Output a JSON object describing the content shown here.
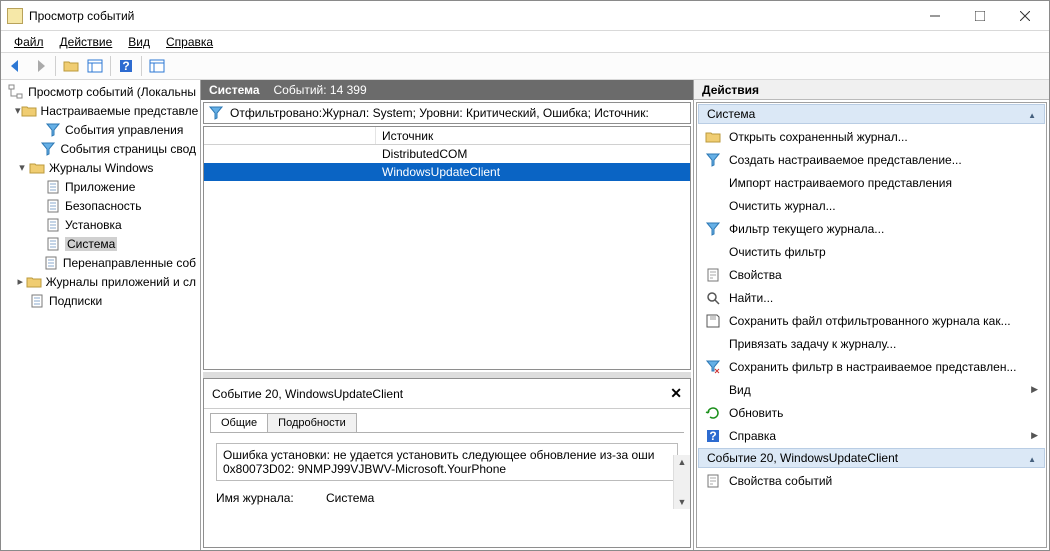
{
  "window": {
    "title": "Просмотр событий"
  },
  "menu": {
    "file": "Файл",
    "action": "Действие",
    "view": "Вид",
    "help": "Справка"
  },
  "tree": {
    "root": "Просмотр событий (Локальны",
    "custom": "Настраиваемые представле",
    "adminEvents": "События управления",
    "summaryEvents": "События страницы свод",
    "winLogs": "Журналы Windows",
    "app": "Приложение",
    "security": "Безопасность",
    "setup": "Установка",
    "system": "Система",
    "forwarded": "Перенаправленные соб",
    "appsServices": "Журналы приложений и сл",
    "subs": "Подписки"
  },
  "center": {
    "headerLog": "Система",
    "headerCount": "Событий: 14 399",
    "filterText": "Отфильтровано:Журнал: System; Уровни: Критический, Ошибка; Источник:",
    "colSource": "Источник",
    "rows": [
      {
        "source": "DistributedCOM",
        "sel": false
      },
      {
        "source": "WindowsUpdateClient",
        "sel": true
      }
    ],
    "detail": {
      "title": "Событие 20, WindowsUpdateClient",
      "tabGeneral": "Общие",
      "tabDetails": "Подробности",
      "message": "Ошибка установки: не удается установить следующее обновление из-за оши 0x80073D02: 9NMPJ99VJBWV-Microsoft.YourPhone",
      "kLogName": "Имя журнала:",
      "vLogName": "Система"
    }
  },
  "actions": {
    "paneTitle": "Действия",
    "section1": "Система",
    "items1": [
      {
        "icon": "folder",
        "label": "Открыть сохраненный журнал..."
      },
      {
        "icon": "funnel",
        "label": "Создать настраиваемое представление..."
      },
      {
        "icon": "",
        "label": "Импорт настраиваемого представления"
      },
      {
        "icon": "",
        "label": "Очистить журнал..."
      },
      {
        "icon": "funnel",
        "label": "Фильтр текущего журнала..."
      },
      {
        "icon": "",
        "label": "Очистить фильтр"
      },
      {
        "icon": "prop",
        "label": "Свойства"
      },
      {
        "icon": "search",
        "label": "Найти..."
      },
      {
        "icon": "save",
        "label": "Сохранить файл отфильтрованного журнала как..."
      },
      {
        "icon": "",
        "label": "Привязать задачу к журналу..."
      },
      {
        "icon": "trash",
        "label": "Сохранить фильтр в настраиваемое представлен..."
      },
      {
        "icon": "",
        "label": "Вид"
      },
      {
        "icon": "refresh",
        "label": "Обновить"
      },
      {
        "icon": "help",
        "label": "Справка"
      }
    ],
    "section2": "Событие 20, WindowsUpdateClient",
    "items2": [
      {
        "icon": "prop",
        "label": "Свойства событий"
      }
    ]
  }
}
